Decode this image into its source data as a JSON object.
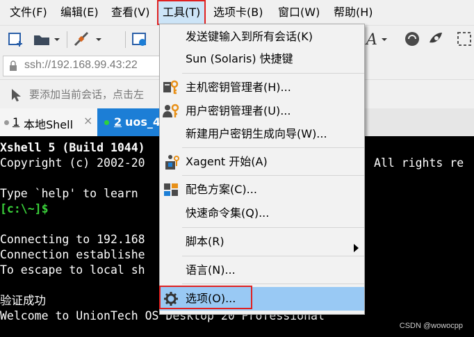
{
  "menubar": {
    "items": [
      "文件(F)",
      "编辑(E)",
      "查看(V)",
      "工具(T)",
      "选项卡(B)",
      "窗口(W)",
      "帮助(H)"
    ]
  },
  "address": {
    "value": "ssh://192.168.99.43:22"
  },
  "hint": {
    "text": "要添加当前会话，点击左"
  },
  "tabs": [
    {
      "number": "1",
      "label": "本地Shell"
    },
    {
      "number": "2",
      "label": "uos_4"
    }
  ],
  "terminal": {
    "lines": [
      "Xshell 5 (Build 1044)",
      "Copyright (c) 2002-20",
      "All rights re",
      "Type `help' to learn",
      "[c:\\~]$",
      "Connecting to 192.168",
      "Connection establishe",
      "To escape to local sh",
      "验证成功",
      "Welcome to UnionTech OS Desktop 20 Professional"
    ]
  },
  "tools_menu": {
    "items": [
      {
        "label": "发送键输入到所有会话(K)",
        "icon": ""
      },
      {
        "label": "Sun (Solaris) 快捷键",
        "icon": ""
      },
      {
        "label": "主机密钥管理者(H)...",
        "icon": "host-key-icon"
      },
      {
        "label": "用户密钥管理者(U)...",
        "icon": "user-key-icon"
      },
      {
        "label": "新建用户密钥生成向导(W)...",
        "icon": ""
      },
      {
        "label": "Xagent 开始(A)",
        "icon": "xagent-icon"
      },
      {
        "label": "配色方案(C)...",
        "icon": "color-scheme-icon"
      },
      {
        "label": "快速命令集(Q)...",
        "icon": ""
      },
      {
        "label": "脚本(R)",
        "icon": ""
      },
      {
        "label": "语言(N)...",
        "icon": ""
      },
      {
        "label": "选项(O)...",
        "icon": "gear-icon"
      }
    ]
  },
  "watermark": "CSDN @wowocpp",
  "colors": {
    "highlight": "#99c9f4",
    "tab_active": "#1c7ed6",
    "prompt": "#3ad13a",
    "annotation": "#e02020"
  }
}
